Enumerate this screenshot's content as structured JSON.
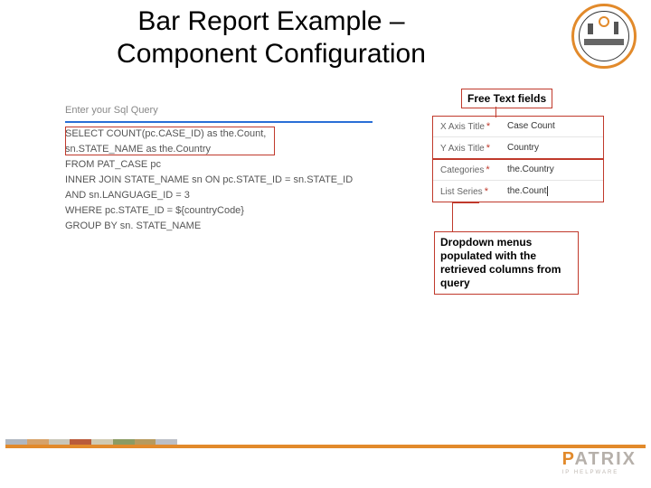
{
  "title": "Bar Report Example – Component Configuration",
  "logo": {
    "name": "conference-badge-icon"
  },
  "query": {
    "label": "Enter your Sql Query",
    "lines": [
      "SELECT COUNT(pc.CASE_ID) as the.Count,",
      "sn.STATE_NAME as the.Country",
      "FROM PAT_CASE pc",
      "INNER JOIN STATE_NAME sn ON pc.STATE_ID = sn.STATE_ID",
      "AND sn.LANGUAGE_ID = 3",
      "WHERE pc.STATE_ID = ${countryCode}",
      "GROUP BY sn. STATE_NAME"
    ]
  },
  "fields": {
    "row1": {
      "label": "X Axis Title",
      "star": "*",
      "value": "Case Count"
    },
    "row2": {
      "label": "Y Axis Title",
      "star": "*",
      "value": "Country"
    },
    "row3": {
      "label": "Categories",
      "star": "*",
      "value": "the.Country"
    },
    "row4": {
      "label": "List Series",
      "star": "*",
      "value": "the.Count"
    }
  },
  "callouts": {
    "free_text": "Free Text fields",
    "dropdown": "Dropdown menus populated with the retrieved columns from query"
  },
  "brand": {
    "name": "PATRIX",
    "sub": "IP HELPWARE"
  }
}
